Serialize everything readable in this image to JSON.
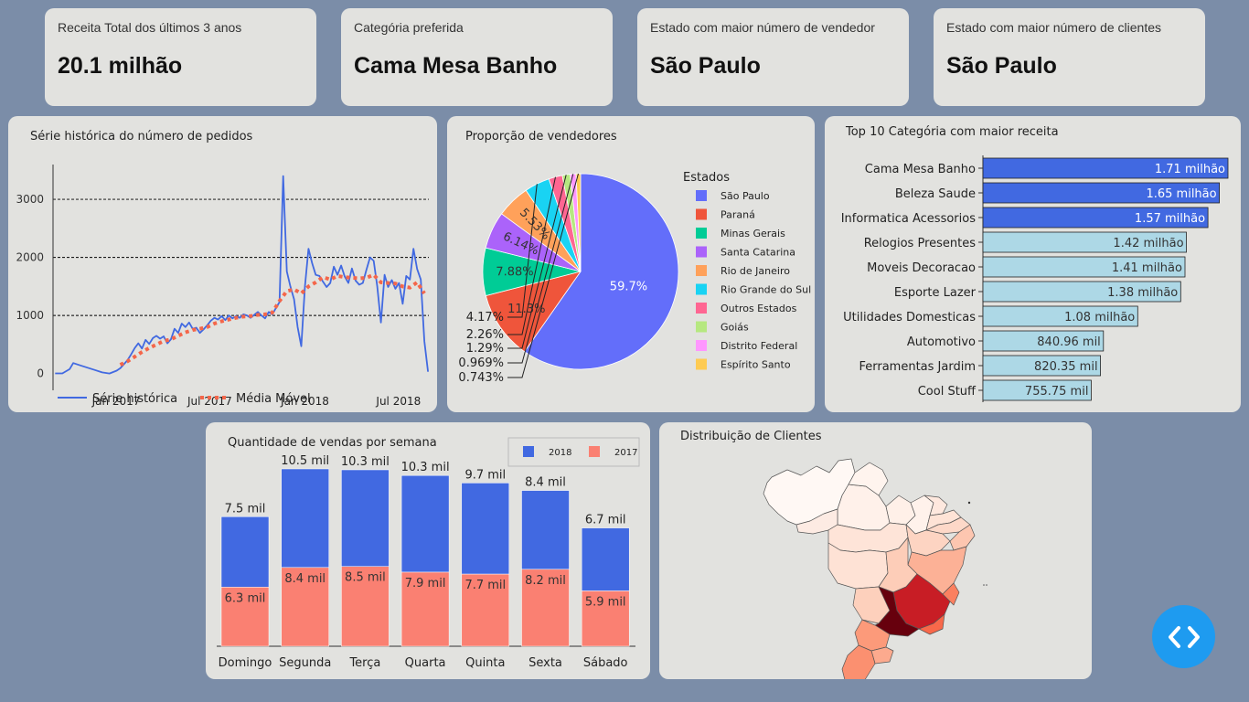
{
  "kpis": [
    {
      "title": "Receita Total dos últimos 3 anos",
      "value": "20.1 milhão"
    },
    {
      "title": "Categória preferida",
      "value": "Cama Mesa Banho"
    },
    {
      "title": "Estado com maior número de vendedor",
      "value": "São Paulo"
    },
    {
      "title": "Estado com maior número de clientes",
      "value": "São Paulo"
    }
  ],
  "panels": {
    "orders_title": "Série histórica do número de pedidos",
    "sellers_title": "Proporção de vendedores",
    "categories_title": "Top 10 Categória com maior receita",
    "weekly_title": "Quantidade de vendas por semana",
    "map_title": "Distribuição de Clientes"
  },
  "colors": {
    "background": "#7b8da8",
    "card": "#e2e2df",
    "series_blue": "#4169e1",
    "moving_avg": "#f4664a",
    "bar_highlight": "#4169e1",
    "bar_normal": "#add8e6",
    "sales_2017": "#fa8072",
    "fab": "#1e9bf0"
  },
  "chart_data": [
    {
      "type": "line",
      "title": "Série histórica do número de pedidos",
      "x_ticks": [
        "Jan 2017",
        "Jul 2017",
        "Jan 2018",
        "Jul 2018"
      ],
      "y_ticks": [
        0,
        1000,
        2000,
        3000
      ],
      "ylim": [
        -100,
        3600
      ],
      "grid": "dashed horizontal",
      "legend_position": "bottom",
      "series": [
        {
          "name": "Série histórica",
          "color": "#4169e1",
          "points": [
            [
              "2016-09-05",
              2
            ],
            [
              "2016-09-19",
              3
            ],
            [
              "2016-10-03",
              75
            ],
            [
              "2016-10-10",
              180
            ],
            [
              "2016-10-24",
              140
            ],
            [
              "2016-11-07",
              100
            ],
            [
              "2016-11-21",
              60
            ],
            [
              "2016-12-05",
              20
            ],
            [
              "2016-12-19",
              1
            ],
            [
              "2017-01-02",
              50
            ],
            [
              "2017-01-09",
              90
            ],
            [
              "2017-01-16",
              160
            ],
            [
              "2017-01-23",
              230
            ],
            [
              "2017-01-30",
              330
            ],
            [
              "2017-02-06",
              440
            ],
            [
              "2017-02-13",
              520
            ],
            [
              "2017-02-20",
              430
            ],
            [
              "2017-02-27",
              580
            ],
            [
              "2017-03-06",
              510
            ],
            [
              "2017-03-13",
              610
            ],
            [
              "2017-03-20",
              650
            ],
            [
              "2017-03-27",
              600
            ],
            [
              "2017-04-03",
              640
            ],
            [
              "2017-04-10",
              520
            ],
            [
              "2017-04-17",
              590
            ],
            [
              "2017-04-24",
              770
            ],
            [
              "2017-05-01",
              700
            ],
            [
              "2017-05-08",
              860
            ],
            [
              "2017-05-15",
              800
            ],
            [
              "2017-05-22",
              880
            ],
            [
              "2017-05-29",
              770
            ],
            [
              "2017-06-05",
              790
            ],
            [
              "2017-06-12",
              700
            ],
            [
              "2017-06-19",
              760
            ],
            [
              "2017-06-26",
              830
            ],
            [
              "2017-07-03",
              910
            ],
            [
              "2017-07-10",
              960
            ],
            [
              "2017-07-17",
              930
            ],
            [
              "2017-07-24",
              990
            ],
            [
              "2017-07-31",
              920
            ],
            [
              "2017-08-07",
              1000
            ],
            [
              "2017-08-14",
              950
            ],
            [
              "2017-08-21",
              990
            ],
            [
              "2017-08-28",
              960
            ],
            [
              "2017-09-04",
              1020
            ],
            [
              "2017-09-11",
              1000
            ],
            [
              "2017-09-18",
              960
            ],
            [
              "2017-09-25",
              1010
            ],
            [
              "2017-10-02",
              1060
            ],
            [
              "2017-10-09",
              1000
            ],
            [
              "2017-10-16",
              950
            ],
            [
              "2017-10-23",
              1060
            ],
            [
              "2017-10-30",
              1020
            ],
            [
              "2017-11-06",
              1130
            ],
            [
              "2017-11-13",
              1230
            ],
            [
              "2017-11-20",
              3400
            ],
            [
              "2017-11-27",
              1760
            ],
            [
              "2017-12-04",
              1500
            ],
            [
              "2017-12-11",
              1280
            ],
            [
              "2017-12-18",
              800
            ],
            [
              "2017-12-25",
              470
            ],
            [
              "2018-01-01",
              1500
            ],
            [
              "2018-01-08",
              2150
            ],
            [
              "2018-01-15",
              1900
            ],
            [
              "2018-01-22",
              1700
            ],
            [
              "2018-01-29",
              1680
            ],
            [
              "2018-02-05",
              1580
            ],
            [
              "2018-02-12",
              1490
            ],
            [
              "2018-02-19",
              1560
            ],
            [
              "2018-02-26",
              1840
            ],
            [
              "2018-03-05",
              1700
            ],
            [
              "2018-03-12",
              1860
            ],
            [
              "2018-03-19",
              1670
            ],
            [
              "2018-03-26",
              1560
            ],
            [
              "2018-04-02",
              1810
            ],
            [
              "2018-04-09",
              1600
            ],
            [
              "2018-04-16",
              1530
            ],
            [
              "2018-04-23",
              1560
            ],
            [
              "2018-04-30",
              1790
            ],
            [
              "2018-05-07",
              2000
            ],
            [
              "2018-05-14",
              1940
            ],
            [
              "2018-05-21",
              1500
            ],
            [
              "2018-05-28",
              880
            ],
            [
              "2018-06-04",
              1700
            ],
            [
              "2018-06-11",
              1490
            ],
            [
              "2018-06-18",
              1610
            ],
            [
              "2018-06-25",
              1460
            ],
            [
              "2018-07-02",
              1560
            ],
            [
              "2018-07-09",
              1200
            ],
            [
              "2018-07-16",
              1680
            ],
            [
              "2018-07-23",
              1620
            ],
            [
              "2018-07-30",
              2150
            ],
            [
              "2018-08-06",
              1800
            ],
            [
              "2018-08-13",
              1620
            ],
            [
              "2018-08-20",
              560
            ],
            [
              "2018-08-27",
              30
            ]
          ]
        },
        {
          "name": "Média Móvel",
          "color": "#f4664a",
          "points": [
            [
              "2017-01-09",
              150
            ],
            [
              "2017-01-23",
              210
            ],
            [
              "2017-02-06",
              290
            ],
            [
              "2017-02-20",
              370
            ],
            [
              "2017-03-06",
              440
            ],
            [
              "2017-03-20",
              500
            ],
            [
              "2017-04-03",
              560
            ],
            [
              "2017-04-17",
              590
            ],
            [
              "2017-05-01",
              650
            ],
            [
              "2017-05-15",
              710
            ],
            [
              "2017-05-29",
              750
            ],
            [
              "2017-06-12",
              770
            ],
            [
              "2017-06-26",
              800
            ],
            [
              "2017-07-10",
              860
            ],
            [
              "2017-07-24",
              900
            ],
            [
              "2017-08-07",
              930
            ],
            [
              "2017-08-21",
              960
            ],
            [
              "2017-09-04",
              980
            ],
            [
              "2017-09-18",
              990
            ],
            [
              "2017-10-02",
              1010
            ],
            [
              "2017-10-16",
              1020
            ],
            [
              "2017-10-30",
              1050
            ],
            [
              "2017-11-13",
              1250
            ],
            [
              "2017-11-27",
              1420
            ],
            [
              "2017-12-11",
              1450
            ],
            [
              "2017-12-25",
              1380
            ],
            [
              "2018-01-08",
              1500
            ],
            [
              "2018-01-22",
              1570
            ],
            [
              "2018-02-05",
              1660
            ],
            [
              "2018-02-19",
              1620
            ],
            [
              "2018-03-05",
              1680
            ],
            [
              "2018-03-19",
              1660
            ],
            [
              "2018-04-02",
              1650
            ],
            [
              "2018-04-16",
              1640
            ],
            [
              "2018-04-30",
              1650
            ],
            [
              "2018-05-14",
              1700
            ],
            [
              "2018-05-28",
              1570
            ],
            [
              "2018-06-11",
              1560
            ],
            [
              "2018-06-25",
              1550
            ],
            [
              "2018-07-09",
              1500
            ],
            [
              "2018-07-23",
              1480
            ],
            [
              "2018-08-06",
              1570
            ],
            [
              "2018-08-20",
              1380
            ]
          ]
        }
      ]
    },
    {
      "type": "pie",
      "title": "Proporção de vendedores",
      "legend_title": "Estados",
      "slices": [
        {
          "label": "São Paulo",
          "value": 59.7,
          "text": "59.7%",
          "color": "#636efa"
        },
        {
          "label": "Paraná",
          "value": 11.3,
          "text": "11.3%",
          "color": "#ef553b"
        },
        {
          "label": "Minas Gerais",
          "value": 7.88,
          "text": "7.88%",
          "color": "#00cc96"
        },
        {
          "label": "Santa Catarina",
          "value": 6.14,
          "text": "6.14%",
          "color": "#ab63fa"
        },
        {
          "label": "Rio de Janeiro",
          "value": 5.53,
          "text": "5.53%",
          "color": "#ffa15a"
        },
        {
          "label": "Rio Grande do Sul",
          "value": 4.17,
          "text": "4.17%",
          "color": "#19d3f3"
        },
        {
          "label": "Outros Estados",
          "value": 2.26,
          "text": "2.26%",
          "color": "#ff6692"
        },
        {
          "label": "Goiás",
          "value": 1.29,
          "text": "1.29%",
          "color": "#b6e880"
        },
        {
          "label": "Distrito Federal",
          "value": 0.969,
          "text": "0.969%",
          "color": "#ff97ff"
        },
        {
          "label": "Espírito Santo",
          "value": 0.743,
          "text": "0.743%",
          "color": "#fecb52"
        }
      ]
    },
    {
      "type": "bar",
      "orientation": "horizontal",
      "title": "Top 10 Categória com maior receita",
      "categories": [
        "Cama Mesa Banho",
        "Beleza Saude",
        "Informatica Acessorios",
        "Relogios Presentes",
        "Moveis Decoracao",
        "Esporte Lazer",
        "Utilidades Domesticas",
        "Automotivo",
        "Ferramentas Jardim",
        "Cool Stuff"
      ],
      "values": [
        1.71,
        1.65,
        1.57,
        1.42,
        1.41,
        1.38,
        1.08,
        0.84096,
        0.82035,
        0.75575
      ],
      "value_unit": "milhão",
      "labels": [
        "1.71 milhão",
        "1.65 milhão",
        "1.57 milhão",
        "1.42 milhão",
        "1.41 milhão",
        "1.38 milhão",
        "1.08 milhão",
        "840.96 mil",
        "820.35 mil",
        "755.75 mil"
      ],
      "highlight_top": 3,
      "xlim": [
        0,
        1.71
      ]
    },
    {
      "type": "bar",
      "stacked": true,
      "title": "Quantidade de vendas por semana",
      "categories": [
        "Domingo",
        "Segunda",
        "Terça",
        "Quarta",
        "Quinta",
        "Sexta",
        "Sábado"
      ],
      "legend_position": "top-right",
      "ylim": [
        0,
        18800
      ],
      "series": [
        {
          "name": "2017",
          "color": "#fa8072",
          "values": [
            6300,
            8400,
            8500,
            7900,
            7700,
            8200,
            5900
          ],
          "labels": [
            "6.3 mil",
            "8.4 mil",
            "8.5 mil",
            "7.9 mil",
            "7.7 mil",
            "8.2 mil",
            "5.9 mil"
          ]
        },
        {
          "name": "2018",
          "color": "#4169e1",
          "values": [
            7500,
            10500,
            10300,
            10300,
            9700,
            8400,
            6700
          ],
          "labels": [
            "7.5 mil",
            "10.5 mil",
            "10.3 mil",
            "10.3 mil",
            "9.7 mil",
            "8.4 mil",
            "6.7 mil"
          ]
        }
      ]
    }
  ]
}
